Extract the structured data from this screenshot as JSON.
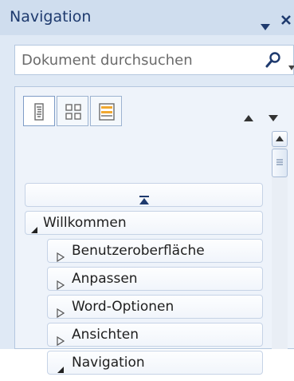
{
  "header": {
    "title": "Navigation",
    "dropdown_icon": "triangle-down-icon",
    "close_icon": "close-icon"
  },
  "search": {
    "placeholder": "Dokument durchsuchen",
    "icon": "search-icon",
    "dropdown_icon": "triangle-down-icon"
  },
  "tabs": [
    {
      "name": "headings",
      "icon": "document-headings-icon",
      "selected": true
    },
    {
      "name": "pages",
      "icon": "page-thumbnails-icon",
      "selected": false
    },
    {
      "name": "results",
      "icon": "search-results-icon",
      "selected": false
    }
  ],
  "nav_buttons": {
    "previous": "triangle-up-icon",
    "next": "triangle-down-icon"
  },
  "tree": {
    "collapse_all_icon": "collapse-to-top-icon",
    "items": [
      {
        "label": "Willkommen",
        "level": 0,
        "expanded": true
      },
      {
        "label": "Benutzeroberfläche",
        "level": 1,
        "expanded": false
      },
      {
        "label": "Anpassen",
        "level": 1,
        "expanded": false
      },
      {
        "label": "Word-Optionen",
        "level": 1,
        "expanded": false
      },
      {
        "label": "Ansichten",
        "level": 1,
        "expanded": false
      },
      {
        "label": "Navigation",
        "level": 1,
        "expanded": true
      }
    ]
  },
  "colors": {
    "header_bg": "#cfddee",
    "panel_bg": "#dfe9f5",
    "title_text": "#1e3a6e",
    "border": "#b4c7df"
  }
}
